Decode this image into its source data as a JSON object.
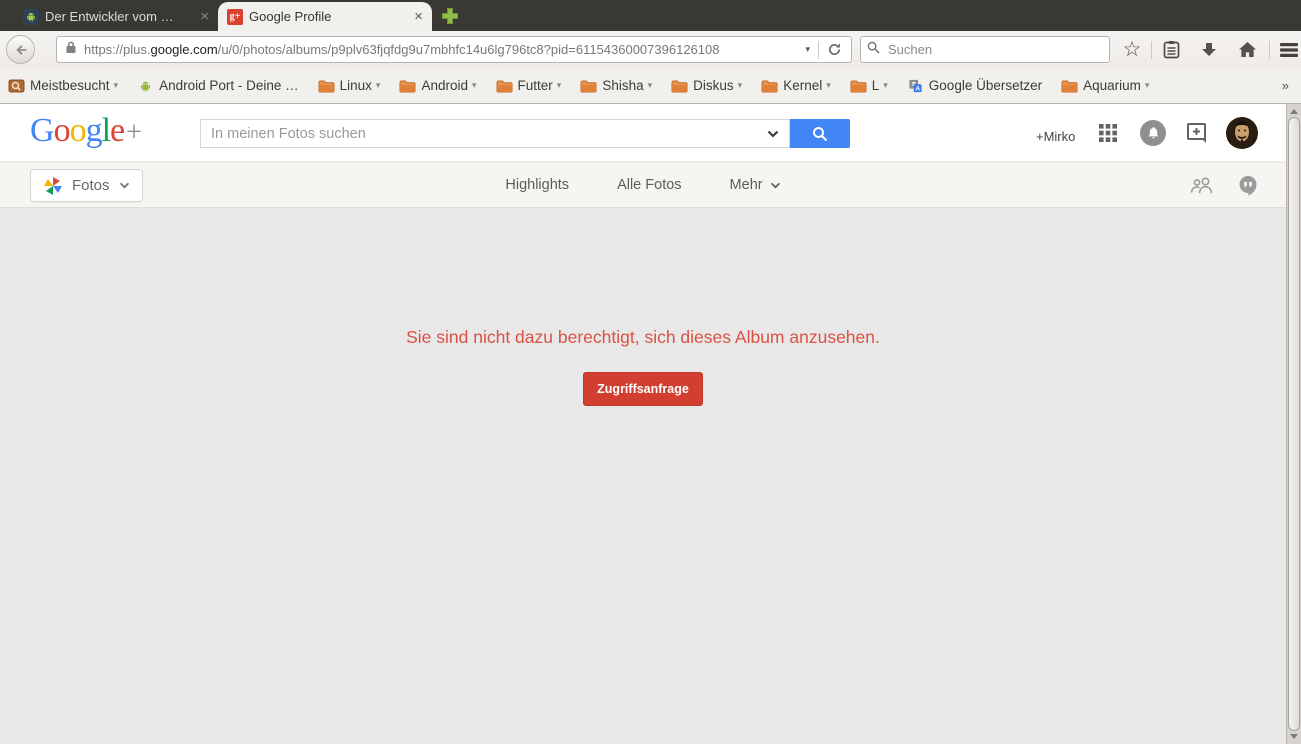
{
  "browser": {
    "tabs": [
      {
        "title": "Der Entwickler vom …"
      },
      {
        "title": "Google Profile"
      }
    ],
    "urlbar": {
      "scheme": "https://plus.",
      "domain": "google.com",
      "path": "/u/0/photos/albums/p9plv63fjqfdg9u7mbhfc14u6lg796tc8?pid=61154360007396126108"
    },
    "search_placeholder": "Suchen",
    "bookmarks": [
      {
        "label": "Meistbesucht",
        "dropdown": true
      },
      {
        "label": "Android Port - Deine …",
        "dropdown": false
      },
      {
        "label": "Linux",
        "dropdown": true
      },
      {
        "label": "Android",
        "dropdown": true
      },
      {
        "label": "Futter",
        "dropdown": true
      },
      {
        "label": "Shisha",
        "dropdown": true
      },
      {
        "label": "Diskus",
        "dropdown": true
      },
      {
        "label": "Kernel",
        "dropdown": true
      },
      {
        "label": "L",
        "dropdown": true
      },
      {
        "label": "Google Übersetzer",
        "dropdown": false
      },
      {
        "label": "Aquarium",
        "dropdown": true
      }
    ]
  },
  "icons": {
    "close": "×",
    "chevron_down_small": "▾",
    "overflow": "»",
    "star": "☆",
    "gplus_glyph": "g+",
    "translate_front": "A"
  },
  "gplus": {
    "logo_letters": [
      "G",
      "o",
      "o",
      "g",
      "l",
      "e"
    ],
    "logo_plus": "+",
    "photos_search_placeholder": "In meinen Fotos suchen",
    "user_link": "+Mirko",
    "app_button_label": "Fotos",
    "nav_items": [
      {
        "label": "Highlights"
      },
      {
        "label": "Alle Fotos"
      }
    ],
    "more_label": "Mehr",
    "error_message": "Sie sind nicht dazu berechtigt, sich dieses Album anzusehen.",
    "request_button_label": "Zugriffsanfrage"
  },
  "colors": {
    "accent_blue": "#4285f4",
    "error_text_red": "#dd5145",
    "error_button_red": "#d23f31",
    "tabbar_background": "#3a3833"
  }
}
